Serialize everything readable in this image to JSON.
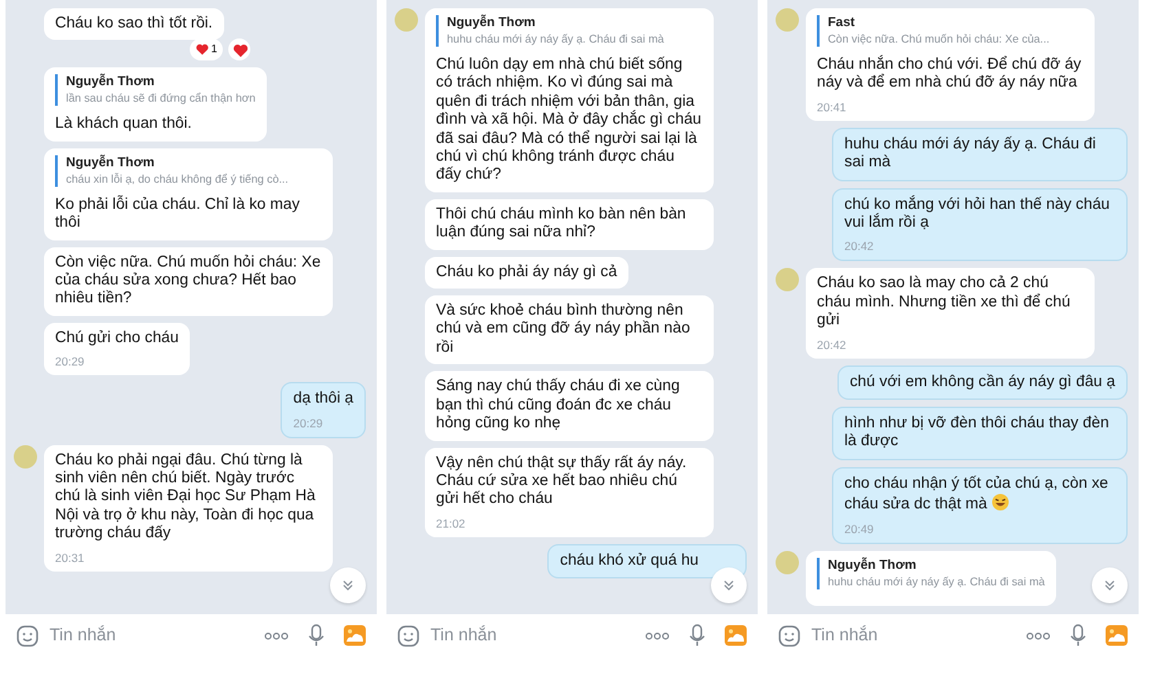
{
  "panels": [
    {
      "messages": [
        {
          "kind": "incoming",
          "avatar": false,
          "text": "Cháu ko sao thì tốt rồi.",
          "reaction": {
            "count": "1"
          },
          "react_button": true
        },
        {
          "kind": "incoming",
          "avatar": false,
          "quote": {
            "author": "Nguyễn Thơm",
            "text": "lần sau cháu sẽ đi đứng cẩn thận hơn"
          },
          "text": "Là khách quan thôi."
        },
        {
          "kind": "incoming",
          "avatar": false,
          "quote": {
            "author": "Nguyễn Thơm",
            "text": "cháu xin lỗi ạ, do cháu không để ý tiếng cò..."
          },
          "text": "Ko phải lỗi của cháu. Chỉ là ko may thôi"
        },
        {
          "kind": "incoming",
          "avatar": false,
          "text": "Còn việc nữa. Chú muốn hỏi cháu: Xe của cháu sửa xong chưa? Hết bao nhiêu tiền?"
        },
        {
          "kind": "incoming",
          "avatar": false,
          "text": "Chú gửi cho cháu",
          "time": "20:29"
        },
        {
          "kind": "outgoing",
          "text": "dạ thôi ạ",
          "time": "20:29"
        },
        {
          "kind": "incoming",
          "avatar": true,
          "text": "Cháu ko phải ngại đâu. Chú từng là sinh viên nên chú biết. Ngày trước chú là sinh viên Đại học Sư Phạm Hà Nội và trọ ở khu này, Toàn đi học qua trường cháu đấy",
          "time": "20:31"
        }
      ],
      "input": {
        "placeholder": "Tin nhắn"
      }
    },
    {
      "messages": [
        {
          "kind": "incoming",
          "avatar": true,
          "quote": {
            "author": "Nguyễn Thơm",
            "text": "huhu cháu mới áy náy ấy ạ. Cháu đi sai mà"
          },
          "text": "Chú luôn dạy em nhà chú biết sống có trách nhiệm. Ko vì đúng sai mà quên đi trách nhiệm với bản thân, gia đình và xã hội. Mà ở đây chắc gì cháu đã sai đâu? Mà có thể người sai lại là chú vì chú không tránh được cháu đấy chứ?"
        },
        {
          "kind": "incoming",
          "avatar": false,
          "text": "Thôi chú cháu mình ko bàn nên bàn luận đúng sai nữa nhỉ?"
        },
        {
          "kind": "incoming",
          "avatar": false,
          "text": "Cháu ko phải áy náy gì cả"
        },
        {
          "kind": "incoming",
          "avatar": false,
          "text": "Và sức khoẻ cháu bình thường nên chú và em cũng đỡ áy náy phần nào rồi"
        },
        {
          "kind": "incoming",
          "avatar": false,
          "text": "Sáng nay chú thấy cháu đi xe cùng bạn thì chú cũng đoán đc xe cháu hỏng cũng ko nhẹ"
        },
        {
          "kind": "incoming",
          "avatar": false,
          "text": "Vậy nên chú thật sự thấy rất áy náy. Cháu cứ sửa xe hết bao nhiêu chú gửi hết cho cháu",
          "time": "21:02"
        },
        {
          "kind": "outgoing",
          "text": "cháu khó xử quá hu"
        }
      ],
      "input": {
        "placeholder": "Tin nhắn"
      }
    },
    {
      "messages": [
        {
          "kind": "incoming",
          "avatar": true,
          "quote": {
            "author": "Fast",
            "text": "Còn việc nữa. Chú muốn hỏi cháu: Xe của..."
          },
          "text": "Cháu nhắn cho chú với. Để chú đỡ áy náy và để em nhà chú đỡ áy náy nữa",
          "time": "20:41"
        },
        {
          "kind": "outgoing",
          "text": "huhu cháu mới áy náy ấy ạ. Cháu đi sai mà"
        },
        {
          "kind": "outgoing",
          "text": "chú ko mắng với hỏi han thế này cháu vui lắm rồi ạ",
          "time": "20:42"
        },
        {
          "kind": "incoming",
          "avatar": true,
          "text": "Cháu ko sao là may cho cả 2 chú cháu mình. Nhưng tiền xe thì để chú gửi",
          "time": "20:42"
        },
        {
          "kind": "outgoing",
          "text": "chú với em không cần áy náy gì đâu ạ"
        },
        {
          "kind": "outgoing",
          "text": "hình như bị vỡ đèn thôi cháu thay đèn là được"
        },
        {
          "kind": "outgoing",
          "text": "cho cháu nhận ý tốt của chú ạ, còn xe cháu sửa dc thật mà",
          "sticker": true,
          "time": "20:49"
        },
        {
          "kind": "incoming",
          "avatar": true,
          "quote": {
            "author": "Nguyễn Thơm",
            "text": "huhu cháu mới áy náy ấy ạ. Cháu đi sai mà"
          }
        }
      ],
      "input": {
        "placeholder": "Tin nhắn"
      }
    }
  ]
}
